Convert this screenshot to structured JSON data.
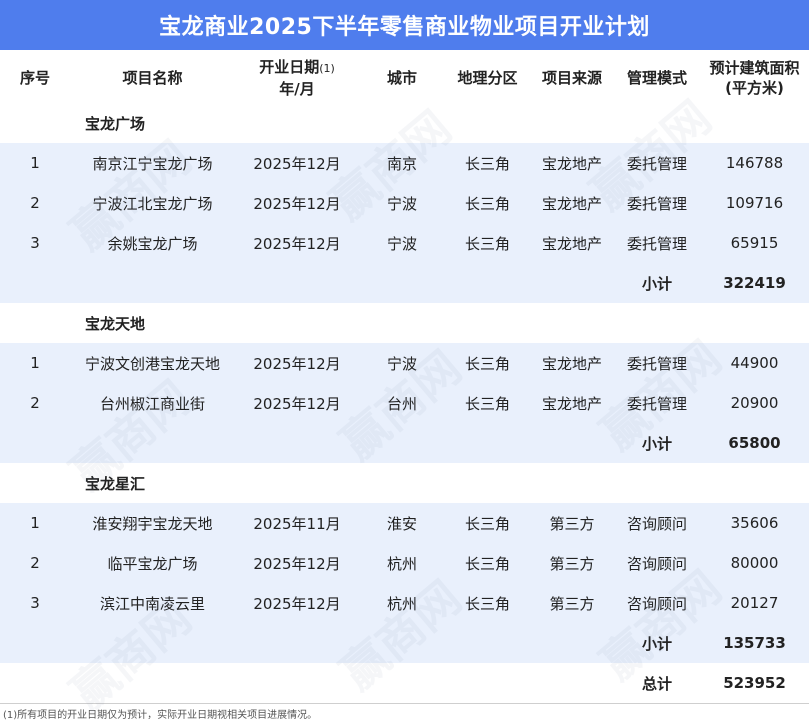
{
  "title": "宝龙商业2025下半年零售商业物业项目开业计划",
  "headers": {
    "no": "序号",
    "name": "项目名称",
    "date_line1": "开业日期",
    "date_sup": "(1)",
    "date_line2": "年/月",
    "city": "城市",
    "region": "地理分区",
    "source": "项目来源",
    "mode": "管理模式",
    "area_line1": "预计建筑面积",
    "area_line2": "(平方米)"
  },
  "groups": [
    {
      "name": "宝龙广场",
      "rows": [
        {
          "no": "1",
          "name": "南京江宁宝龙广场",
          "date": "2025年12月",
          "city": "南京",
          "region": "长三角",
          "source": "宝龙地产",
          "mode": "委托管理",
          "area": "146788"
        },
        {
          "no": "2",
          "name": "宁波江北宝龙广场",
          "date": "2025年12月",
          "city": "宁波",
          "region": "长三角",
          "source": "宝龙地产",
          "mode": "委托管理",
          "area": "109716"
        },
        {
          "no": "3",
          "name": "余姚宝龙广场",
          "date": "2025年12月",
          "city": "宁波",
          "region": "长三角",
          "source": "宝龙地产",
          "mode": "委托管理",
          "area": "65915"
        }
      ],
      "subtotal_label": "小计",
      "subtotal": "322419"
    },
    {
      "name": "宝龙天地",
      "rows": [
        {
          "no": "1",
          "name": "宁波文创港宝龙天地",
          "date": "2025年12月",
          "city": "宁波",
          "region": "长三角",
          "source": "宝龙地产",
          "mode": "委托管理",
          "area": "44900"
        },
        {
          "no": "2",
          "name": "台州椒江商业街",
          "date": "2025年12月",
          "city": "台州",
          "region": "长三角",
          "source": "宝龙地产",
          "mode": "委托管理",
          "area": "20900"
        }
      ],
      "subtotal_label": "小计",
      "subtotal": "65800"
    },
    {
      "name": "宝龙星汇",
      "rows": [
        {
          "no": "1",
          "name": "淮安翔宇宝龙天地",
          "date": "2025年11月",
          "city": "淮安",
          "region": "长三角",
          "source": "第三方",
          "mode": "咨询顾问",
          "area": "35606"
        },
        {
          "no": "2",
          "name": "临平宝龙广场",
          "date": "2025年12月",
          "city": "杭州",
          "region": "长三角",
          "source": "第三方",
          "mode": "咨询顾问",
          "area": "80000"
        },
        {
          "no": "3",
          "name": "滨江中南凌云里",
          "date": "2025年12月",
          "city": "杭州",
          "region": "长三角",
          "source": "第三方",
          "mode": "咨询顾问",
          "area": "20127"
        }
      ],
      "subtotal_label": "小计",
      "subtotal": "135733"
    }
  ],
  "total_label": "总计",
  "total": "523952",
  "footnote": "(1)所有项目的开业日期仅为预计，实际开业日期视相关项目进展情况。",
  "watermark_text": "赢商网",
  "colors": {
    "title_bg": "#4f7ded",
    "row_shade": "#e9f0fc"
  }
}
